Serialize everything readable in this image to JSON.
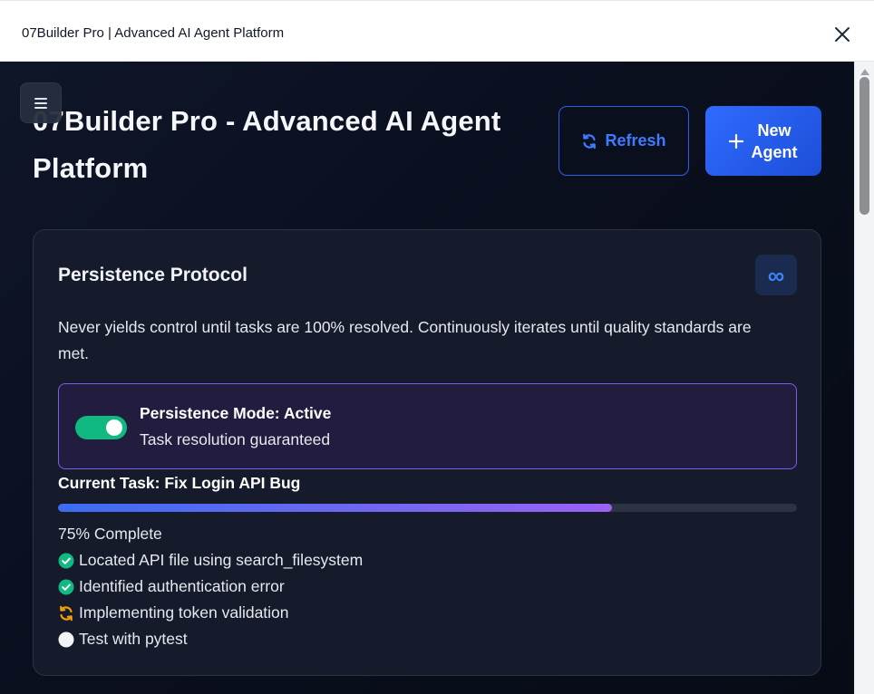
{
  "window": {
    "title": "07Builder Pro | Advanced AI Agent Platform",
    "close_icon": "close-icon"
  },
  "header": {
    "menu_icon": "hamburger-icon",
    "title": "07Builder Pro - Advanced AI Agent Platform",
    "refresh_label": "Refresh",
    "new_agent_label": "New Agent"
  },
  "persistence": {
    "title": "Persistence Protocol",
    "badge_icon": "infinity-icon",
    "badge_symbol": "∞",
    "description": "Never yields control until tasks are 100% resolved. Continuously iterates until quality standards are met.",
    "mode_title": "Persistence Mode: Active",
    "mode_subtitle": "Task resolution guaranteed",
    "mode_enabled": true,
    "current_task": "Current Task: Fix Login API Bug",
    "progress_percent": 75,
    "progress_text": "75% Complete",
    "steps": [
      {
        "label": "Located API file using search_filesystem",
        "status": "done",
        "icon": "check-circle-icon"
      },
      {
        "label": "Identified authentication error",
        "status": "done",
        "icon": "check-circle-icon"
      },
      {
        "label": "Implementing token validation",
        "status": "in-progress",
        "icon": "sync-icon"
      },
      {
        "label": "Test with pytest",
        "status": "pending",
        "icon": "circle-icon"
      }
    ]
  },
  "colors": {
    "accent_blue": "#2f6bff",
    "success_green": "#10b981",
    "progress_purple": "#9a62f3",
    "in_progress_orange": "#f59e0b",
    "mode_border": "#7c5cf0"
  }
}
